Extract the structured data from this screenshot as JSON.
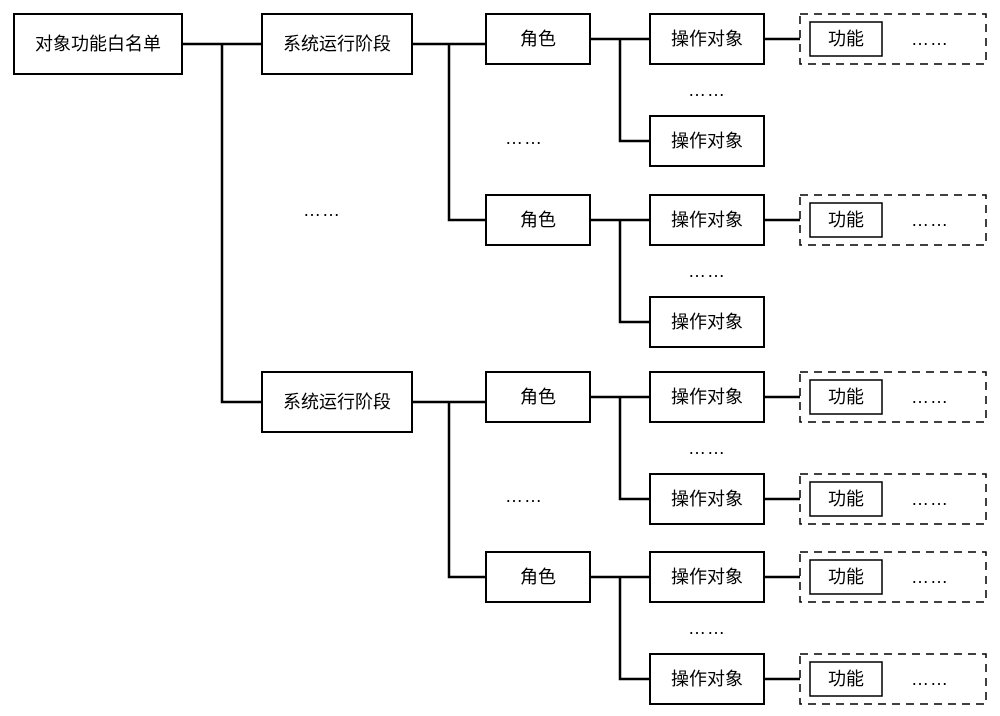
{
  "diagram": {
    "root": "对象功能白名单",
    "phase": "系统运行阶段",
    "role": "角色",
    "object": "操作对象",
    "function": "功能",
    "ellipsis": "……"
  }
}
